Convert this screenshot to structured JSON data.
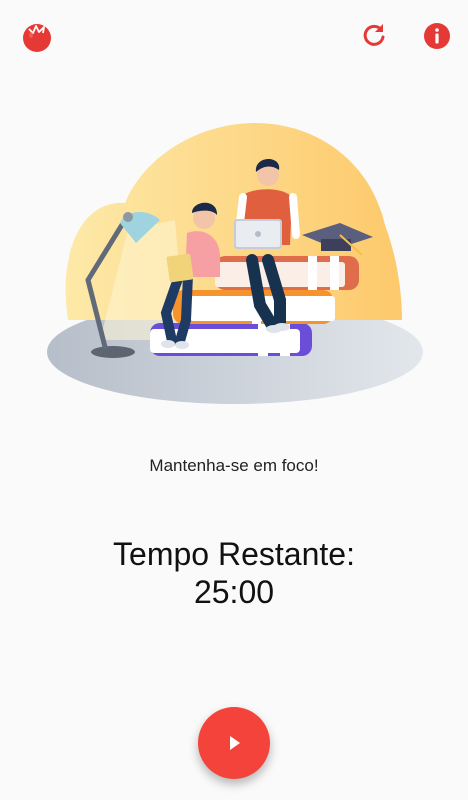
{
  "header": {
    "logo_icon": "tomato-icon",
    "refresh_icon": "refresh-icon",
    "info_icon": "info-icon",
    "accent_color": "#f4433a"
  },
  "main": {
    "illustration": "students-studying-on-books-illustration",
    "motto": "Mantenha-se em foco!",
    "timer_label": "Tempo Restante:",
    "timer_value": "25:00"
  },
  "controls": {
    "play_icon": "play-icon"
  }
}
